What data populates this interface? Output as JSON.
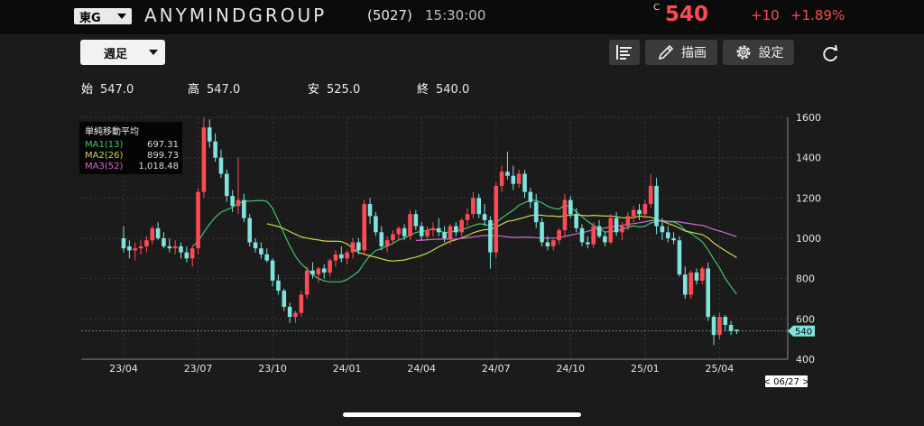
{
  "header": {
    "market": "東G",
    "company": "ANYMINDGROUP",
    "code": "(5027)",
    "time": "15:30:00",
    "price_mark": "C",
    "price": "540",
    "change": "+10",
    "change_pct": "+1.89%"
  },
  "toolbar": {
    "period": "週足",
    "draw_label": "描画",
    "settings_label": "設定",
    "icons": [
      "indicator-list-icon",
      "pencil-icon",
      "gear-icon",
      "refresh-icon"
    ]
  },
  "ohlc": {
    "open_label": "始",
    "open": "547.0",
    "high_label": "高",
    "high": "547.0",
    "low_label": "安",
    "low": "525.0",
    "close_label": "終",
    "close": "540.0"
  },
  "legend": {
    "title": "単純移動平均",
    "ma1": {
      "name": "MA1(13)",
      "value": "697.31"
    },
    "ma2": {
      "name": "MA2(26)",
      "value": "899.73"
    },
    "ma3": {
      "name": "MA3(52)",
      "value": "1,018.48"
    }
  },
  "colors": {
    "up": "#ff4a55",
    "down": "#7fe3de",
    "ma1": "#3ec46d",
    "ma2": "#c8d84a",
    "ma3": "#d36ad0"
  },
  "chart_data": {
    "type": "candlestick",
    "ylim": [
      400,
      1600
    ],
    "yticks": [
      400,
      600,
      800,
      1000,
      1200,
      1400,
      1600
    ],
    "xticks": [
      "23/04",
      "23/07",
      "23/10",
      "24/01",
      "24/04",
      "24/07",
      "24/10",
      "25/01",
      "25/04"
    ],
    "xtick_index": [
      0,
      13,
      26,
      39,
      52,
      65,
      78,
      91,
      104
    ],
    "last_price_label": "540",
    "date_label": "< 06/27 >",
    "candles": [
      [
        1000,
        1060,
        930,
        950
      ],
      [
        960,
        990,
        900,
        940
      ],
      [
        940,
        980,
        890,
        950
      ],
      [
        950,
        990,
        920,
        960
      ],
      [
        960,
        1010,
        930,
        990
      ],
      [
        990,
        1060,
        970,
        1050
      ],
      [
        1050,
        1080,
        990,
        1000
      ],
      [
        1000,
        1030,
        950,
        960
      ],
      [
        960,
        1000,
        930,
        950
      ],
      [
        950,
        990,
        920,
        960
      ],
      [
        960,
        980,
        900,
        930
      ],
      [
        930,
        960,
        880,
        900
      ],
      [
        900,
        960,
        860,
        950
      ],
      [
        950,
        1250,
        920,
        1230
      ],
      [
        1230,
        1600,
        1200,
        1550
      ],
      [
        1550,
        1590,
        1450,
        1480
      ],
      [
        1480,
        1520,
        1380,
        1400
      ],
      [
        1400,
        1440,
        1300,
        1320
      ],
      [
        1320,
        1340,
        1180,
        1210
      ],
      [
        1210,
        1240,
        1130,
        1160
      ],
      [
        1160,
        1400,
        1120,
        1190
      ],
      [
        1190,
        1220,
        1080,
        1100
      ],
      [
        1100,
        1120,
        960,
        980
      ],
      [
        980,
        1000,
        930,
        950
      ],
      [
        950,
        980,
        900,
        920
      ],
      [
        920,
        950,
        880,
        890
      ],
      [
        890,
        900,
        760,
        790
      ],
      [
        790,
        820,
        720,
        740
      ],
      [
        740,
        750,
        640,
        660
      ],
      [
        660,
        680,
        580,
        610
      ],
      [
        610,
        640,
        580,
        630
      ],
      [
        630,
        740,
        610,
        720
      ],
      [
        720,
        860,
        700,
        840
      ],
      [
        840,
        880,
        800,
        820
      ],
      [
        820,
        860,
        780,
        850
      ],
      [
        850,
        870,
        800,
        830
      ],
      [
        830,
        900,
        810,
        890
      ],
      [
        890,
        940,
        860,
        920
      ],
      [
        920,
        960,
        880,
        900
      ],
      [
        900,
        940,
        870,
        930
      ],
      [
        930,
        1000,
        900,
        980
      ],
      [
        980,
        1000,
        920,
        940
      ],
      [
        940,
        1190,
        920,
        1170
      ],
      [
        1170,
        1200,
        1070,
        1110
      ],
      [
        1110,
        1130,
        1010,
        1030
      ],
      [
        1030,
        1060,
        940,
        960
      ],
      [
        960,
        1010,
        930,
        990
      ],
      [
        990,
        1040,
        970,
        1020
      ],
      [
        1020,
        1060,
        990,
        1050
      ],
      [
        1050,
        1070,
        990,
        1010
      ],
      [
        1010,
        1140,
        990,
        1120
      ],
      [
        1120,
        1140,
        1040,
        1060
      ],
      [
        1060,
        1080,
        990,
        1010
      ],
      [
        1010,
        1060,
        990,
        1040
      ],
      [
        1040,
        1080,
        1010,
        1050
      ],
      [
        1050,
        1100,
        1010,
        1030
      ],
      [
        1030,
        1060,
        980,
        1000
      ],
      [
        1000,
        1070,
        970,
        1060
      ],
      [
        1060,
        1080,
        1010,
        1030
      ],
      [
        1030,
        1100,
        1010,
        1090
      ],
      [
        1090,
        1150,
        1060,
        1120
      ],
      [
        1120,
        1230,
        1100,
        1200
      ],
      [
        1200,
        1220,
        1100,
        1120
      ],
      [
        1120,
        1170,
        1060,
        1090
      ],
      [
        1090,
        1110,
        850,
        930
      ],
      [
        930,
        1280,
        900,
        1260
      ],
      [
        1260,
        1360,
        1230,
        1330
      ],
      [
        1330,
        1430,
        1290,
        1310
      ],
      [
        1310,
        1360,
        1240,
        1270
      ],
      [
        1270,
        1340,
        1250,
        1320
      ],
      [
        1320,
        1340,
        1200,
        1230
      ],
      [
        1230,
        1250,
        1150,
        1180
      ],
      [
        1180,
        1220,
        1050,
        1080
      ],
      [
        1080,
        1100,
        960,
        980
      ],
      [
        980,
        1010,
        940,
        960
      ],
      [
        960,
        1000,
        940,
        990
      ],
      [
        990,
        1050,
        970,
        1040
      ],
      [
        1040,
        1220,
        1010,
        1190
      ],
      [
        1190,
        1210,
        1100,
        1120
      ],
      [
        1120,
        1150,
        1030,
        1050
      ],
      [
        1050,
        1070,
        960,
        980
      ],
      [
        980,
        1010,
        950,
        970
      ],
      [
        970,
        1080,
        950,
        1060
      ],
      [
        1060,
        1090,
        1000,
        1010
      ],
      [
        1010,
        1030,
        960,
        980
      ],
      [
        980,
        1120,
        970,
        1100
      ],
      [
        1100,
        1130,
        1010,
        1030
      ],
      [
        1030,
        1080,
        990,
        1060
      ],
      [
        1060,
        1130,
        1040,
        1110
      ],
      [
        1110,
        1160,
        1080,
        1140
      ],
      [
        1140,
        1170,
        1090,
        1120
      ],
      [
        1120,
        1190,
        1100,
        1170
      ],
      [
        1170,
        1320,
        1150,
        1260
      ],
      [
        1260,
        1300,
        1020,
        1060
      ],
      [
        1060,
        1100,
        990,
        1030
      ],
      [
        1030,
        1060,
        980,
        1000
      ],
      [
        1000,
        1030,
        970,
        990
      ],
      [
        990,
        1010,
        810,
        820
      ],
      [
        820,
        860,
        700,
        720
      ],
      [
        720,
        840,
        700,
        830
      ],
      [
        830,
        850,
        770,
        790
      ],
      [
        790,
        860,
        770,
        850
      ],
      [
        850,
        880,
        590,
        610
      ],
      [
        610,
        620,
        470,
        520
      ],
      [
        520,
        630,
        500,
        610
      ],
      [
        610,
        620,
        540,
        570
      ],
      [
        570,
        590,
        520,
        540
      ],
      [
        547,
        547,
        525,
        540
      ]
    ]
  }
}
